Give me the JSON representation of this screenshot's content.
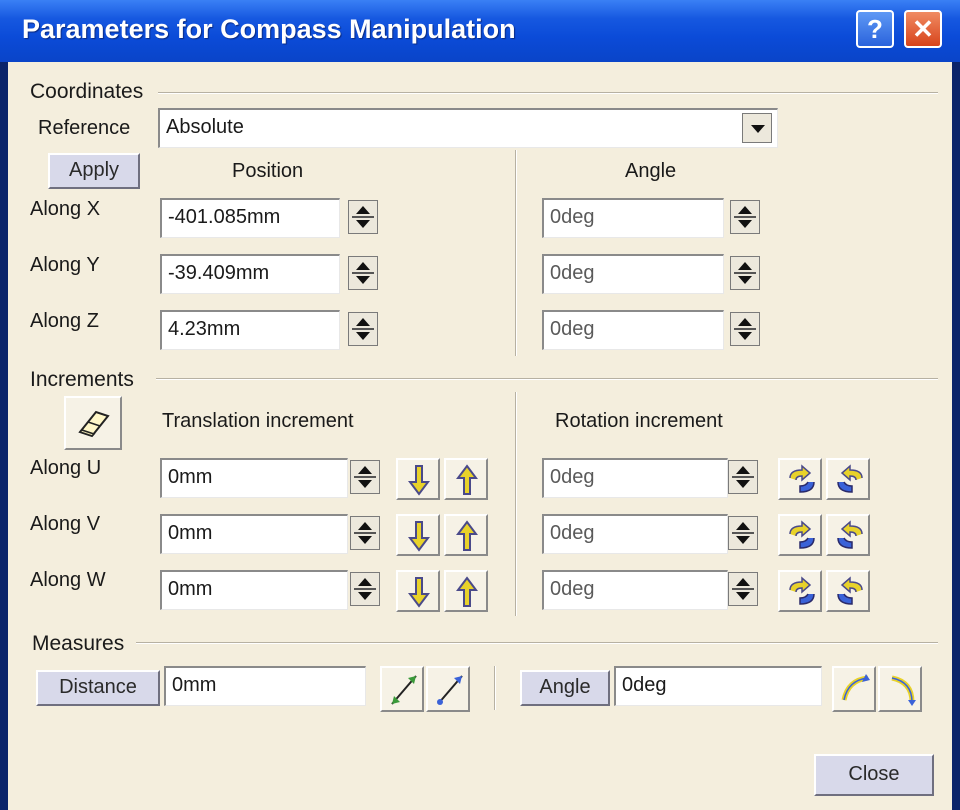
{
  "window": {
    "title": "Parameters for Compass Manipulation",
    "help_label": "?",
    "close_label": "✕"
  },
  "coordinates": {
    "section_label": "Coordinates",
    "reference_label": "Reference",
    "reference_value": "Absolute",
    "apply_label": "Apply",
    "position_header": "Position",
    "angle_header": "Angle",
    "rows": [
      {
        "label": "Along X",
        "position": "-401.085mm",
        "angle": "0deg"
      },
      {
        "label": "Along Y",
        "position": "-39.409mm",
        "angle": "0deg"
      },
      {
        "label": "Along Z",
        "position": "4.23mm",
        "angle": "0deg"
      }
    ]
  },
  "increments": {
    "section_label": "Increments",
    "translation_header": "Translation increment",
    "rotation_header": "Rotation increment",
    "rows": [
      {
        "label": "Along U",
        "translation": "0mm",
        "rotation": "0deg"
      },
      {
        "label": "Along V",
        "translation": "0mm",
        "rotation": "0deg"
      },
      {
        "label": "Along W",
        "translation": "0mm",
        "rotation": "0deg"
      }
    ]
  },
  "measures": {
    "section_label": "Measures",
    "distance_label": "Distance",
    "distance_value": "0mm",
    "angle_label": "Angle",
    "angle_value": "0deg"
  },
  "footer": {
    "close_label": "Close"
  },
  "colors": {
    "title_bar": "#0b4bd8",
    "dialog_bg": "#f4eedd",
    "button_face": "#d8d9ea",
    "icon_yellow": "#e8d22a",
    "icon_blue": "#3a62d8"
  }
}
